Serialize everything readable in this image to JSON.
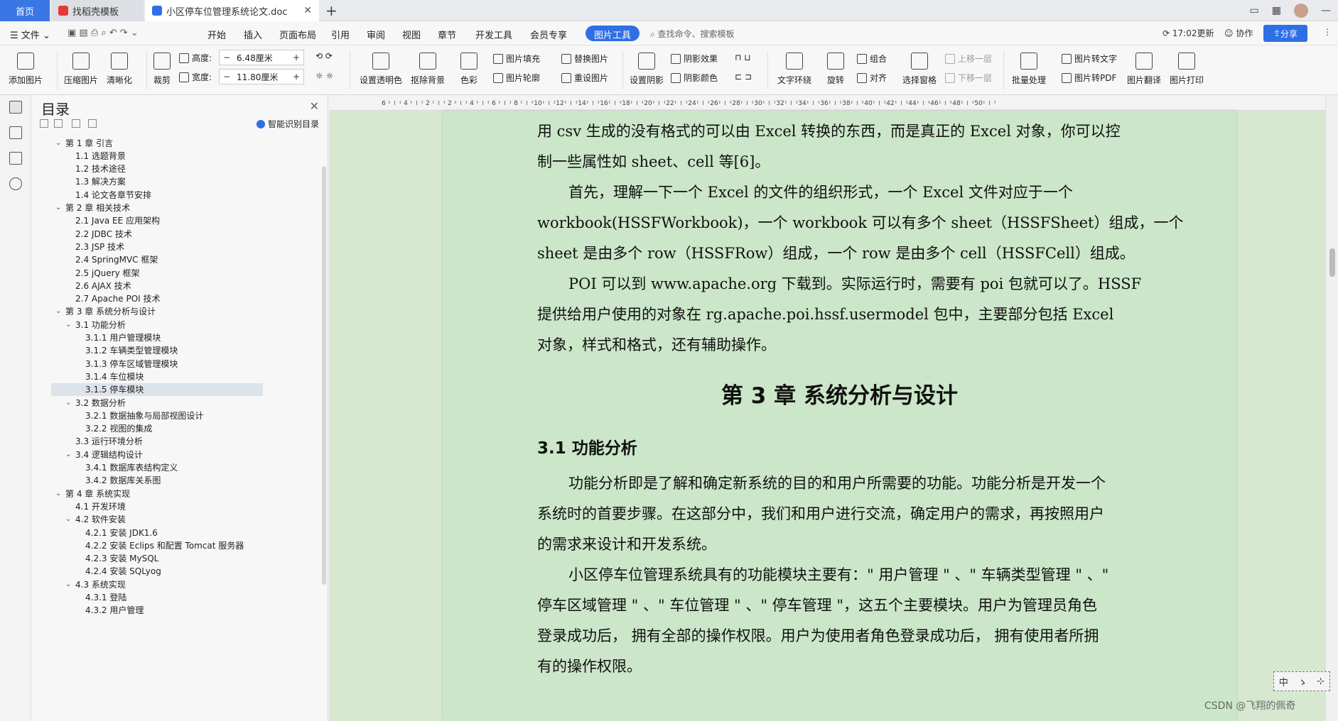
{
  "titlebar": {
    "tab_home": "首页",
    "tab_templates": "找稻壳模板",
    "tab_doc": "小区停车位管理系统论文.doc"
  },
  "menubar": {
    "file": "文件",
    "items": [
      "开始",
      "插入",
      "页面布局",
      "引用",
      "审阅",
      "视图",
      "章节",
      "开发工具",
      "会员专享"
    ],
    "active": "图片工具",
    "search_placeholder": "查找命令、搜索模板",
    "update": "17:02更新",
    "collab": "协作",
    "share": "分享"
  },
  "ribbon": {
    "add_picture": "添加图片",
    "compress": "压缩图片",
    "sharpen": "清晰化",
    "crop": "裁剪",
    "height_label": "高度:",
    "height_value": "6.48厘米",
    "width_label": "宽度:",
    "width_value": "11.80厘米",
    "set_transparent": "设置透明色",
    "remove_bg": "抠除背景",
    "color": "色彩",
    "fill": "图片填充",
    "outline": "图片轮廓",
    "replace": "替换图片",
    "reset": "重设图片",
    "set_shadow": "设置阴影",
    "shadow_effect": "阴影效果",
    "shadow_color": "阴影颜色",
    "text_wrap": "文字环绕",
    "rotate": "旋转",
    "group": "组合",
    "align": "对齐",
    "select_pane": "选择窗格",
    "bring_forward": "上移一层",
    "send_backward": "下移一层",
    "batch": "批量处理",
    "to_text": "图片转文字",
    "to_pdf": "图片转PDF",
    "translate": "图片翻译",
    "print": "图片打印"
  },
  "toc": {
    "title": "目录",
    "smart": "智能识别目录",
    "items": [
      {
        "level": 1,
        "caret": "v",
        "text": "第 1 章  引言"
      },
      {
        "level": 2,
        "caret": "",
        "text": "1.1  选题背景"
      },
      {
        "level": 2,
        "caret": "",
        "text": "1.2  技术途径"
      },
      {
        "level": 2,
        "caret": "",
        "text": "1.3  解决方案"
      },
      {
        "level": 2,
        "caret": "",
        "text": "1.4  论文各章节安排"
      },
      {
        "level": 1,
        "caret": "v",
        "text": "第 2 章  相关技术"
      },
      {
        "level": 2,
        "caret": "",
        "text": "2.1 Java EE 应用架构"
      },
      {
        "level": 2,
        "caret": "",
        "text": "2.2 JDBC 技术"
      },
      {
        "level": 2,
        "caret": "",
        "text": "2.3 JSP 技术"
      },
      {
        "level": 2,
        "caret": "",
        "text": "2.4 SpringMVC 框架"
      },
      {
        "level": 2,
        "caret": "",
        "text": "2.5 jQuery  框架"
      },
      {
        "level": 2,
        "caret": "",
        "text": "2.6 AJAX 技术"
      },
      {
        "level": 2,
        "caret": "",
        "text": "2.7 Apache POI 技术"
      },
      {
        "level": 1,
        "caret": "v",
        "text": "第 3 章  系统分析与设计"
      },
      {
        "level": 2,
        "caret": "v",
        "text": "3.1  功能分析"
      },
      {
        "level": 3,
        "caret": "",
        "text": "3.1.1 用户管理模块"
      },
      {
        "level": 3,
        "caret": "",
        "text": "3.1.2 车辆类型管理模块"
      },
      {
        "level": 3,
        "caret": "",
        "text": "3.1.3 停车区域管理模块"
      },
      {
        "level": 3,
        "caret": "",
        "text": "3.1.4 车位模块"
      },
      {
        "level": 3,
        "caret": "",
        "text": "3.1.5 停车模块",
        "selected": true
      },
      {
        "level": 2,
        "caret": "v",
        "text": "3.2  数据分析"
      },
      {
        "level": 3,
        "caret": "",
        "text": "3.2.1 数据抽象与局部视图设计"
      },
      {
        "level": 3,
        "caret": "",
        "text": "3.2.2 视图的集成"
      },
      {
        "level": 2,
        "caret": "",
        "text": "3.3  运行环境分析"
      },
      {
        "level": 2,
        "caret": "v",
        "text": "3.4  逻辑结构设计"
      },
      {
        "level": 3,
        "caret": "",
        "text": "3.4.1 数据库表结构定义"
      },
      {
        "level": 3,
        "caret": "",
        "text": "3.4.2 数据库关系图"
      },
      {
        "level": 1,
        "caret": "v",
        "text": "第 4 章  系统实现"
      },
      {
        "level": 2,
        "caret": "",
        "text": "4.1  开发环境"
      },
      {
        "level": 2,
        "caret": "v",
        "text": "4.2  软件安装"
      },
      {
        "level": 3,
        "caret": "",
        "text": "4.2.1 安装 JDK1.6"
      },
      {
        "level": 3,
        "caret": "",
        "text": "4.2.2 安装 Eclips 和配置 Tomcat 服务器"
      },
      {
        "level": 3,
        "caret": "",
        "text": "4.2.3 安装 MySQL"
      },
      {
        "level": 3,
        "caret": "",
        "text": "4.2.4 安装 SQLyog"
      },
      {
        "level": 2,
        "caret": "v",
        "text": "4.3  系统实现"
      },
      {
        "level": 3,
        "caret": "",
        "text": "4.3.1 登陆"
      },
      {
        "level": 3,
        "caret": "",
        "text": "4.3.2 用户管理"
      }
    ]
  },
  "ruler": {
    "labels": [
      "6",
      "4",
      "2",
      "2",
      "4",
      "6",
      "8",
      "10",
      "12",
      "14",
      "16",
      "18",
      "20",
      "22",
      "24",
      "26",
      "28",
      "30",
      "32",
      "34",
      "36",
      "38",
      "40",
      "42",
      "44",
      "46",
      "48",
      "50"
    ]
  },
  "doc": {
    "lines": [
      "用 csv 生成的没有格式的可以由 Excel 转换的东西，而是真正的 Excel 对象，你可以控",
      "制一些属性如 sheet、cell 等[6]。",
      "首先，理解一下一个 Excel 的文件的组织形式，一个 Excel 文件对应于一个",
      "workbook(HSSFWorkbook)，一个 workbook 可以有多个 sheet（HSSFSheet）组成，一个",
      "sheet 是由多个 row（HSSFRow）组成，一个 row 是由多个 cell（HSSFCell）组成。",
      "POI 可以到 www.apache.org 下载到。实际运行时，需要有 poi 包就可以了。HSSF",
      "提供给用户使用的对象在 rg.apache.poi.hssf.usermodel 包中，主要部分包括 Excel",
      "对象，样式和格式，还有辅助操作。"
    ],
    "chapter": "第 3 章  系统分析与设计",
    "section": "3.1  功能分析",
    "lines2": [
      "功能分析即是了解和确定新系统的目的和用户所需要的功能。功能分析是开发一个",
      "系统时的首要步骤。在这部分中，我们和用户进行交流，确定用户的需求，再按照用户",
      "的需求来设计和开发系统。",
      "小区停车位管理系统具有的功能模块主要有：\" 用户管理 \" 、\" 车辆类型管理 \" 、\"",
      "停车区域管理 \" 、\" 车位管理 \" 、\" 停车管理 \"，这五个主要模块。用户为管理员角色",
      "登录成功后， 拥有全部的操作权限。用户为使用者角色登录成功后， 拥有使用者所拥",
      "有的操作权限。"
    ]
  },
  "ime": [
    "中",
    "ゝ",
    "⊹"
  ],
  "watermark": "CSDN @飞翔的佩奇"
}
